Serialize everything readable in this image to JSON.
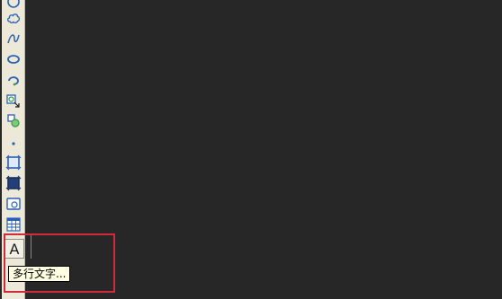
{
  "colors": {
    "canvas_background": "#272727",
    "toolbar_background": "#ece9d8",
    "icon_blue": "#2a5fb8",
    "icon_green": "#3a9a3a",
    "highlight_border": "#d12a3a",
    "tooltip_background": "#ffffe1"
  },
  "draw_toolbar": {
    "tools": [
      {
        "icon": "circle-icon"
      },
      {
        "icon": "revision-cloud-icon"
      },
      {
        "icon": "spline-icon"
      },
      {
        "icon": "ellipse-icon"
      },
      {
        "icon": "ellipse-arc-icon"
      },
      {
        "icon": "insert-block-icon"
      },
      {
        "icon": "make-block-icon"
      },
      {
        "icon": "point-icon"
      },
      {
        "icon": "hatch-icon"
      },
      {
        "icon": "gradient-icon"
      },
      {
        "icon": "region-icon"
      },
      {
        "icon": "table-icon"
      },
      {
        "icon": "multiline-text-icon",
        "glyph": "A"
      }
    ]
  },
  "tooltip": {
    "text": "多行文字..."
  }
}
